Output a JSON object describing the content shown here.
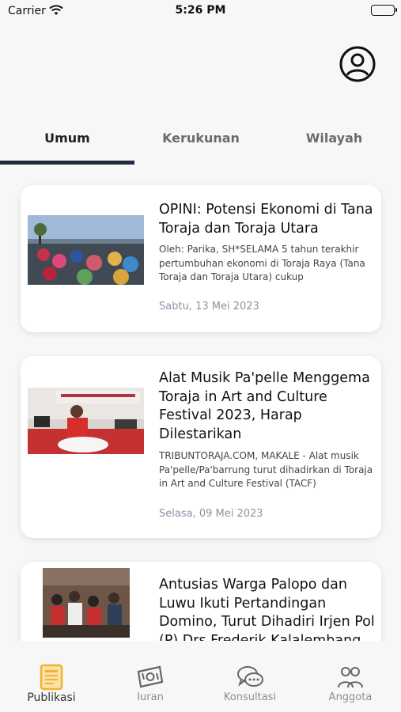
{
  "status_bar": {
    "carrier": "Carrier",
    "time": "5:26 PM"
  },
  "header": {
    "profile_icon": "user-circle-icon"
  },
  "tabs": [
    {
      "label": "Umum",
      "active": true
    },
    {
      "label": "Kerukunan",
      "active": false
    },
    {
      "label": "Wilayah",
      "active": false
    }
  ],
  "news": [
    {
      "title": "OPINI: Potensi Ekonomi di Tana Toraja dan Toraja Utara",
      "excerpt": "Oleh: Parika, SH*SELAMA 5 tahun terakhir pertumbuhan ekonomi di Toraja Raya (Tana Toraja dan Toraja Utara) cukup",
      "date": "Sabtu, 13 Mei 2023"
    },
    {
      "title": "Alat Musik Pa'pelle Menggema Toraja in Art and Culture Festival 2023, Harap Dilestarikan",
      "excerpt": "TRIBUNTORAJA.COM, MAKALE - Alat musik Pa'pelle/Pa'barrung turut dihadirkan di Toraja in Art and Culture Festival (TACF)",
      "date": "Selasa, 09 Mei 2023"
    },
    {
      "title": "Antusias Warga Palopo dan Luwu Ikuti Pertandingan Domino, Turut Dihadiri Irjen Pol (P) Drs Frederik Kalalembang",
      "excerpt": "",
      "date": ""
    }
  ],
  "bottom_nav": [
    {
      "label": "Publikasi",
      "icon": "newspaper-icon",
      "active": true
    },
    {
      "label": "Iuran",
      "icon": "money-icon",
      "active": false
    },
    {
      "label": "Konsultasi",
      "icon": "chat-bubbles-icon",
      "active": false
    },
    {
      "label": "Anggota",
      "icon": "users-icon",
      "active": false
    }
  ],
  "colors": {
    "background": "#f7f7f7",
    "tab_indicator": "#1f2a3c",
    "active_nav_icon": "#f2b233",
    "date_text": "#8a93a3"
  }
}
